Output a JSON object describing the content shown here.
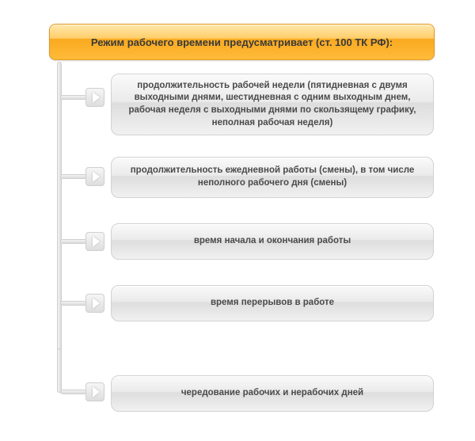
{
  "header": {
    "title": "Режим рабочего времени предусматривает (ст. 100 ТК РФ):"
  },
  "items": [
    {
      "text": "продолжительность рабочей недели (пятидневная с двумя выходными днями, шестидневная с одним выходным днем, рабочая неделя с выходными днями по скользящему графику, неполная рабочая неделя)"
    },
    {
      "text": "продолжительность ежедневной работы (смены), в том числе неполного рабочего дня (смены)"
    },
    {
      "text": "время начала и окончания работы"
    },
    {
      "text": "время перерывов в работе"
    },
    {
      "text": "чередование рабочих и нерабочих дней"
    }
  ],
  "colors": {
    "accent": "#f9a91f",
    "box": "#e6e6e6"
  }
}
